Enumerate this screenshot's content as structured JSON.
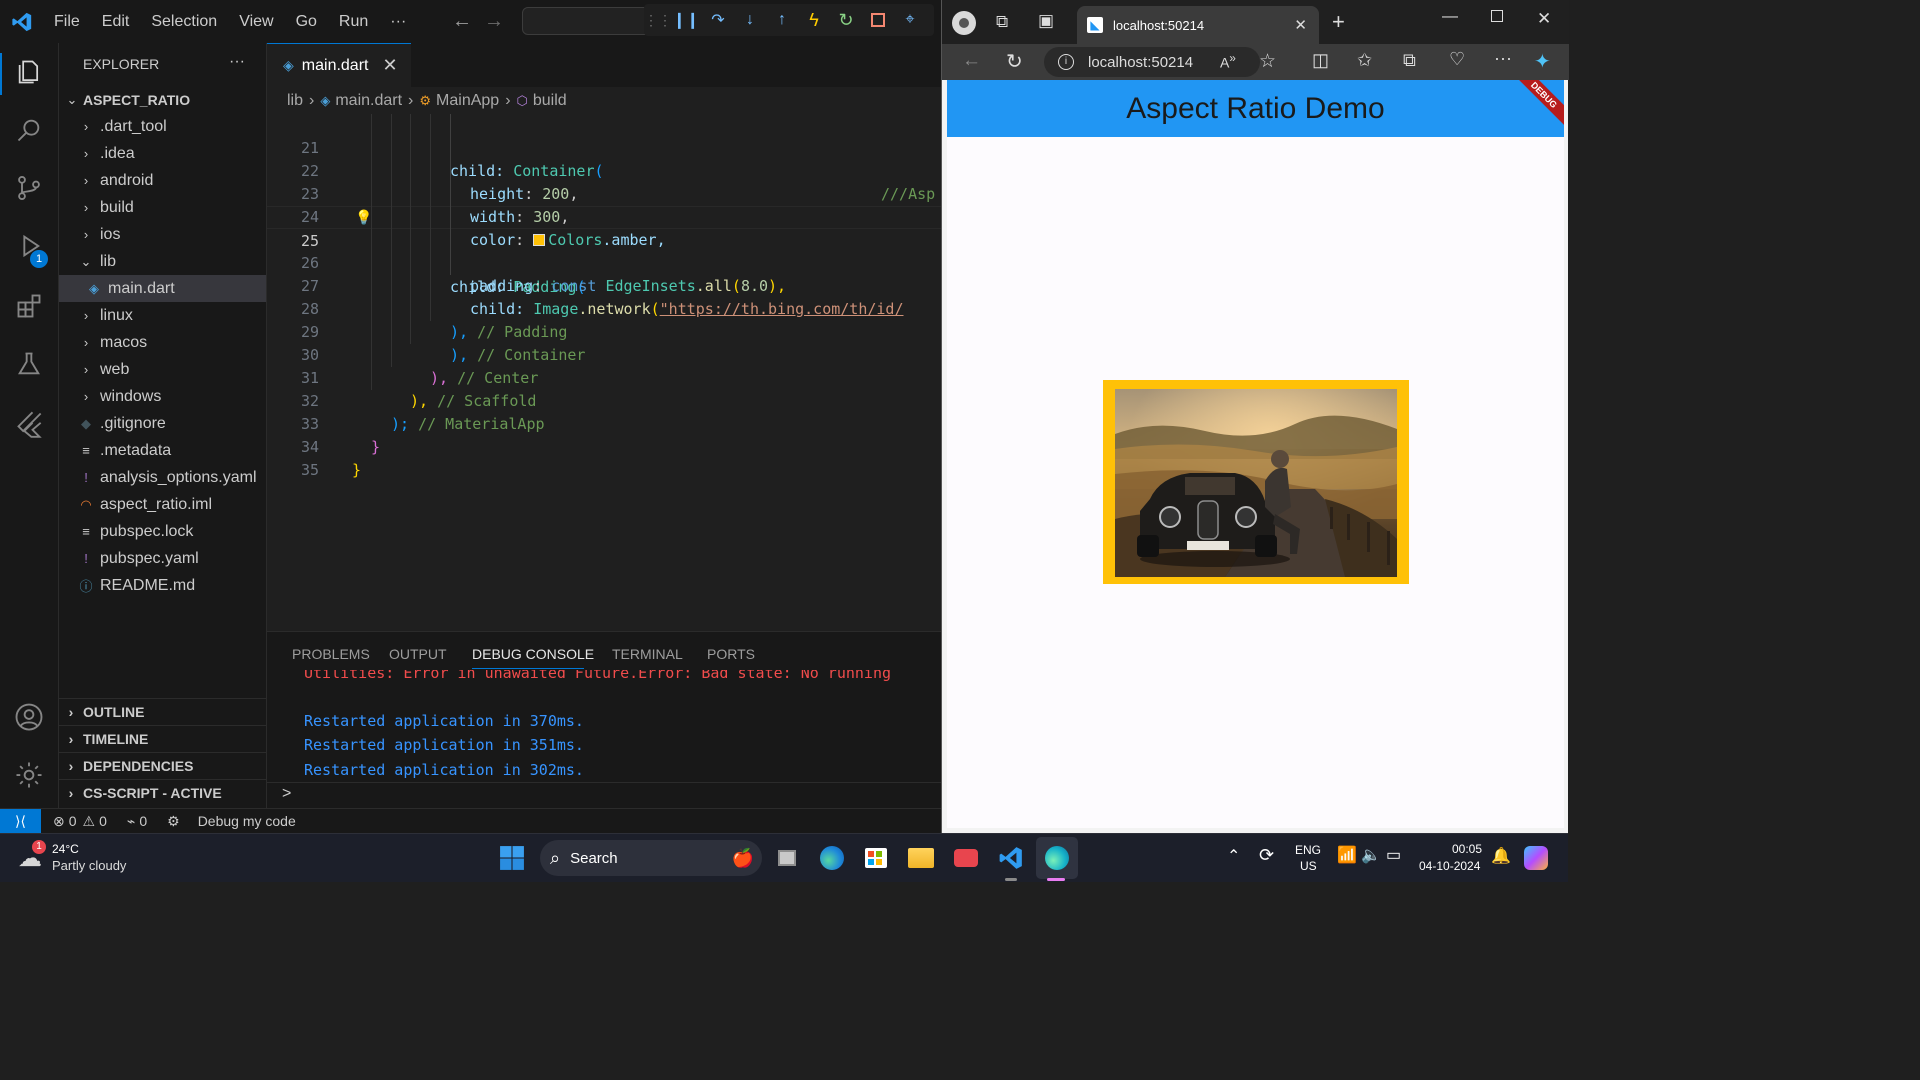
{
  "vscode": {
    "menu": [
      "File",
      "Edit",
      "Selection",
      "View",
      "Go",
      "Run",
      "···"
    ],
    "explorer_title": "EXPLORER",
    "explorer_more": "···",
    "project": "ASPECT_RATIO",
    "tree": [
      {
        "label": ".dart_tool",
        "chev": "›"
      },
      {
        "label": ".idea",
        "chev": "›"
      },
      {
        "label": "android",
        "chev": "›"
      },
      {
        "label": "build",
        "chev": "›"
      },
      {
        "label": "ios",
        "chev": "›"
      },
      {
        "label": "lib",
        "chev": "⌄"
      },
      {
        "label": "main.dart",
        "chev": ""
      },
      {
        "label": "linux",
        "chev": "›"
      },
      {
        "label": "macos",
        "chev": "›"
      },
      {
        "label": "web",
        "chev": "›"
      },
      {
        "label": "windows",
        "chev": "›"
      },
      {
        "label": ".gitignore",
        "chev": ""
      },
      {
        "label": ".metadata",
        "chev": ""
      },
      {
        "label": "analysis_options.yaml",
        "chev": ""
      },
      {
        "label": "aspect_ratio.iml",
        "chev": ""
      },
      {
        "label": "pubspec.lock",
        "chev": ""
      },
      {
        "label": "pubspec.yaml",
        "chev": ""
      },
      {
        "label": "README.md",
        "chev": ""
      }
    ],
    "sections": [
      "OUTLINE",
      "TIMELINE",
      "DEPENDENCIES",
      "CS-SCRIPT - ACTIVE"
    ],
    "debug_badge": "1",
    "tab_label": "main.dart",
    "breadcrumb": {
      "folder": "lib",
      "file": "main.dart",
      "class": "MainApp",
      "method": "build"
    },
    "line_numbers": [
      "21",
      "22",
      "23",
      "24",
      "25",
      "26",
      "27",
      "28",
      "29",
      "30",
      "31",
      "32",
      "33",
      "34",
      "35"
    ],
    "code": {
      "l21_a": "child: ",
      "l21_b": "Container",
      "l21_c": "(",
      "l21_cmt": "///Asp",
      "l22_a": "height",
      "l22_b": ": ",
      "l22_c": "200",
      "l22_d": ",",
      "l23_a": "width",
      "l23_b": ": ",
      "l23_c": "300",
      "l23_d": ",",
      "l24_a": "color",
      "l24_b": ": ",
      "l24_c": "Colors",
      "l24_d": ".amber,",
      "l25_a": "child: ",
      "l25_b": "Padding",
      "l25_c": "(",
      "l26_a": "padding",
      "l26_b": ": ",
      "l26_c": "const ",
      "l26_d": "EdgeInsets",
      "l26_e": ".all",
      "l26_f": "(",
      "l26_g": "8.0",
      "l26_h": "),",
      "l27_a": "child: ",
      "l27_b": "Image",
      "l27_c": ".network",
      "l27_d": "(",
      "l27_e": "\"https://th.bing.com/th/id/",
      "l28_a": "), ",
      "l28_b": "// Padding",
      "l29_a": "), ",
      "l29_b": "// Container",
      "l30_a": "), ",
      "l30_b": "// Center",
      "l31_a": "), ",
      "l31_b": "// Scaffold",
      "l32_a": "); ",
      "l32_b": "// MaterialApp",
      "l33_a": "}",
      "l34_a": "}"
    },
    "panel_tabs": [
      "PROBLEMS",
      "OUTPUT",
      "DEBUG CONSOLE",
      "TERMINAL",
      "PORTS"
    ],
    "console_lines": [
      "Utilities: Error in unawaited Future.Error: Bad state: No running",
      "Restarted application in 370ms.",
      "Restarted application in 351ms.",
      "Restarted application in 302ms."
    ],
    "prompt": ">",
    "status": {
      "errors": "0",
      "warnings": "0",
      "ports": "0",
      "debug": "Debug my code"
    }
  },
  "browser": {
    "tab_title": "localhost:50214",
    "address": "localhost:50214",
    "app_title": "Aspect Ratio Demo",
    "debug_banner": "DEBUG",
    "colors": {
      "appbar": "#2196f3",
      "amber": "#ffc107"
    }
  },
  "taskbar": {
    "weather_temp": "24°C",
    "weather_desc": "Partly cloudy",
    "weather_badge": "1",
    "search": "Search",
    "lang_top": "ENG",
    "lang_bottom": "US",
    "time": "00:05",
    "date": "04-10-2024"
  }
}
